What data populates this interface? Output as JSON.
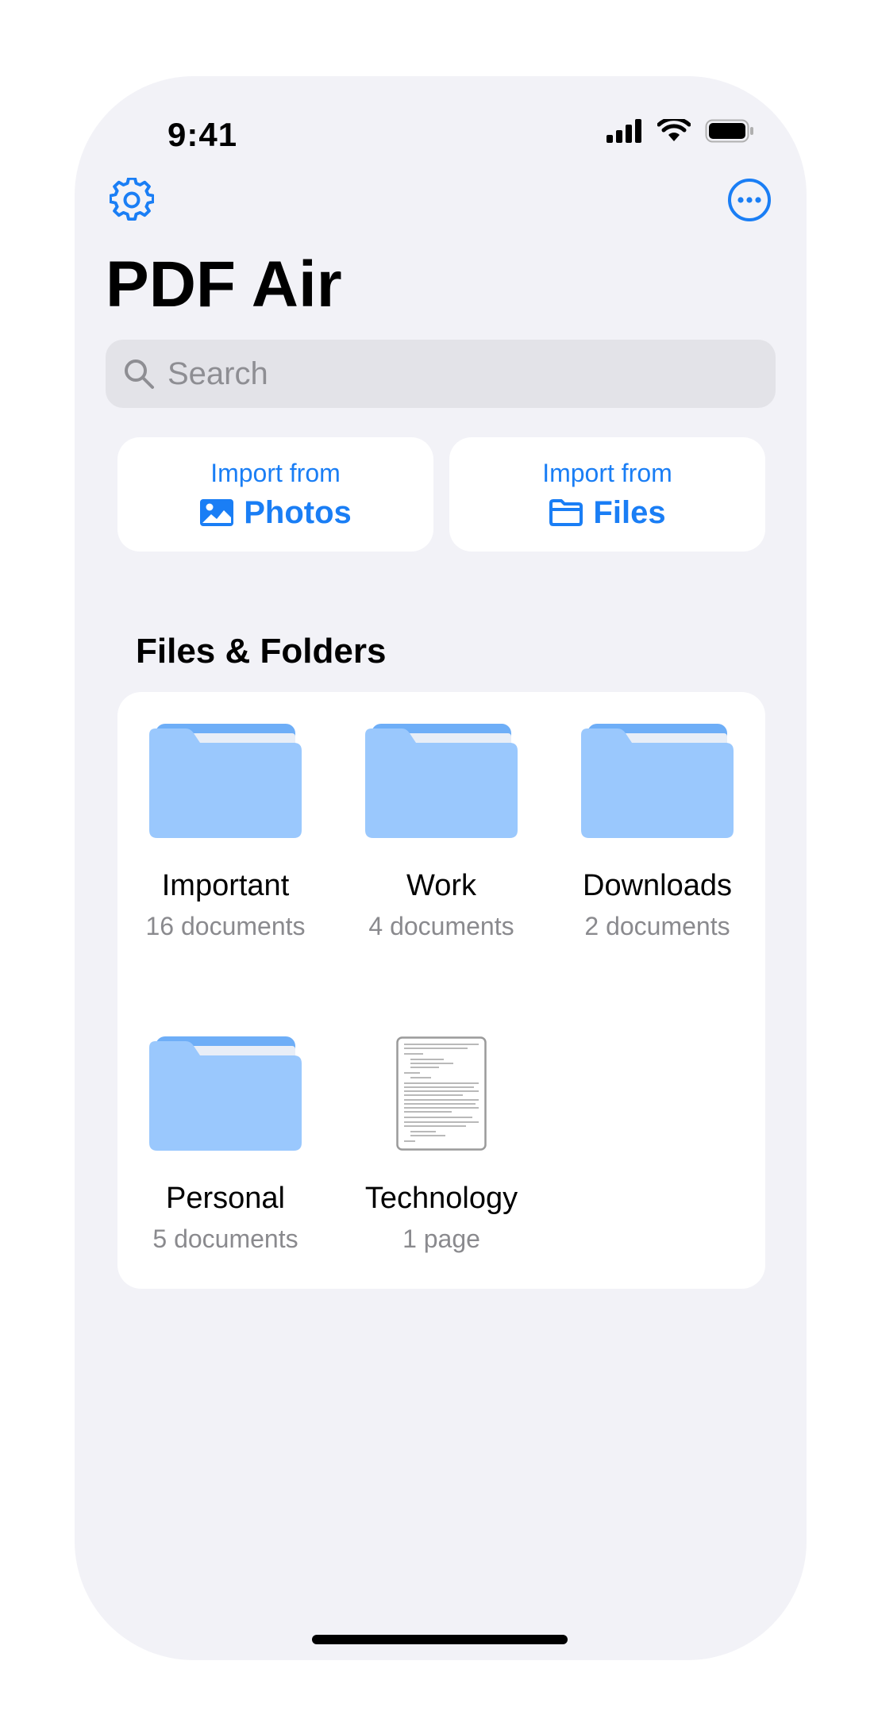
{
  "status_bar": {
    "time": "9:41"
  },
  "header": {
    "title": "PDF Air",
    "settings_icon": "gear-icon",
    "more_icon": "ellipsis-circle-icon"
  },
  "search": {
    "placeholder": "Search",
    "value": ""
  },
  "imports": [
    {
      "top": "Import from",
      "label": "Photos",
      "icon": "photo-icon"
    },
    {
      "top": "Import from",
      "label": "Files",
      "icon": "folder-icon"
    }
  ],
  "section": {
    "title": "Files & Folders"
  },
  "items": [
    {
      "name": "Important",
      "meta": "16 documents",
      "kind": "folder"
    },
    {
      "name": "Work",
      "meta": "4 documents",
      "kind": "folder"
    },
    {
      "name": "Downloads",
      "meta": "2 documents",
      "kind": "folder"
    },
    {
      "name": "Personal",
      "meta": "5 documents",
      "kind": "folder"
    },
    {
      "name": "Technology",
      "meta": "1 page",
      "kind": "document"
    }
  ],
  "colors": {
    "accent": "#1a7ef5",
    "background": "#f2f2f7",
    "folder_front": "#9ac8fd",
    "folder_back": "#6eaef7"
  }
}
